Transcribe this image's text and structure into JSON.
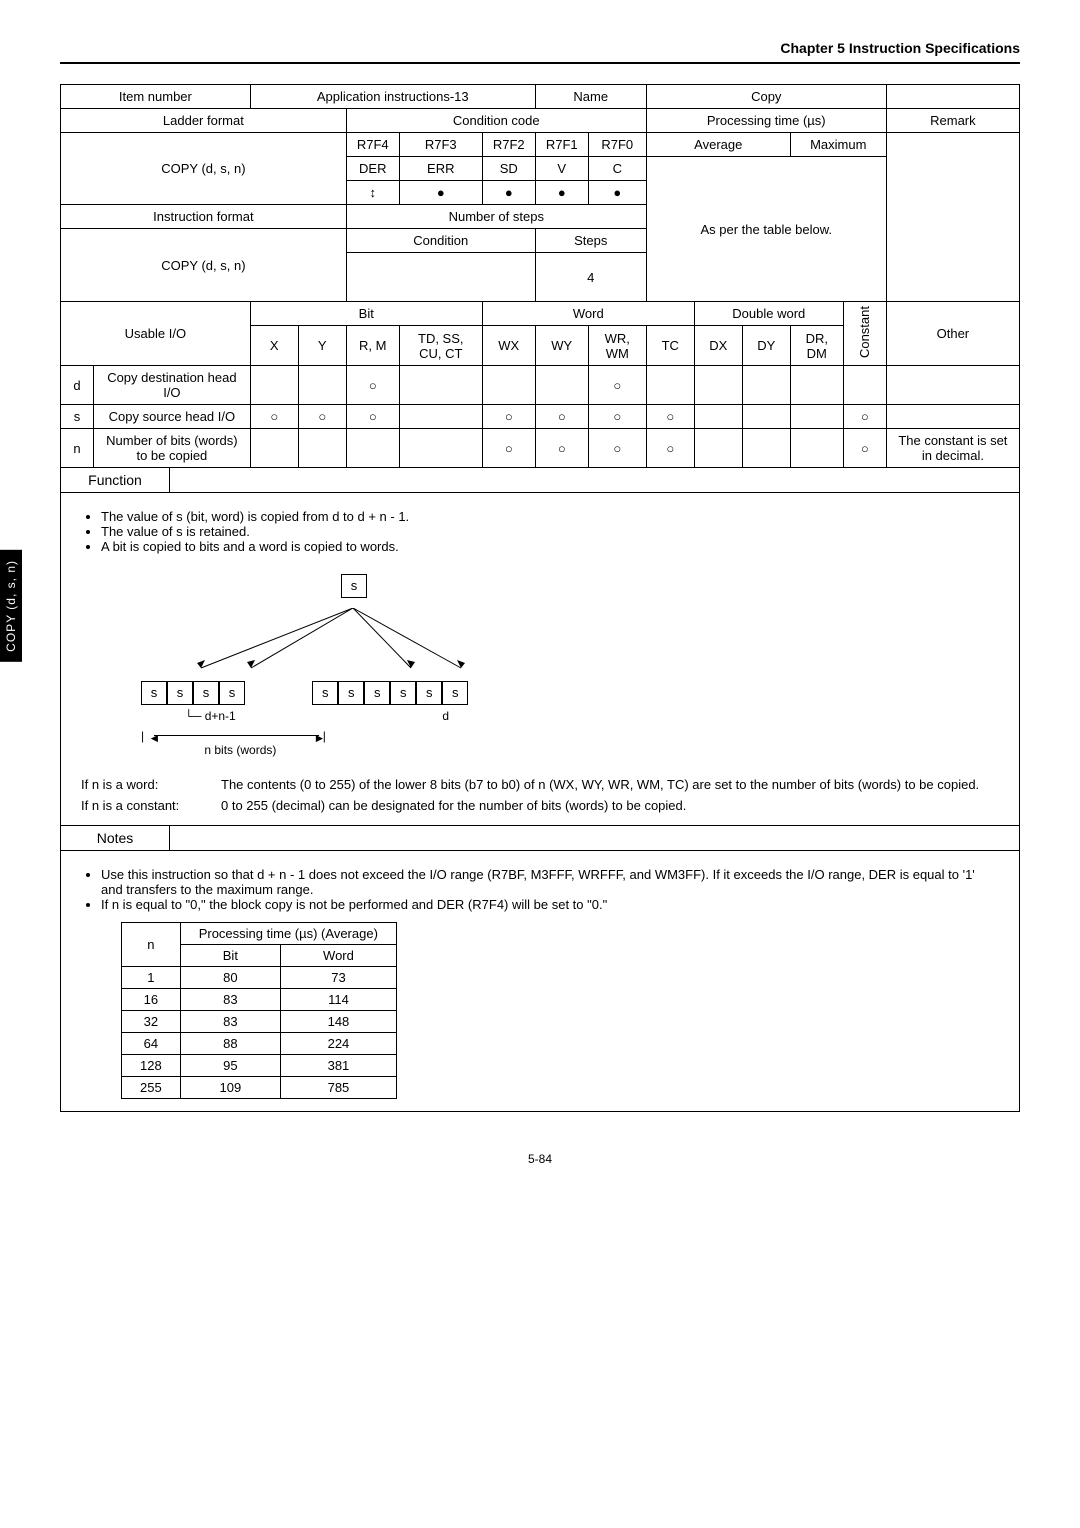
{
  "header": {
    "chapter": "Chapter 5  Instruction Specifications"
  },
  "sideTab": "COPY (d, s, n)",
  "row1": {
    "itemNumberLabel": "Item number",
    "itemNumberValue": "Application instructions-13",
    "nameLabel": "Name",
    "nameValue": "Copy"
  },
  "row2": {
    "ladderLabel": "Ladder format",
    "condLabel": "Condition code",
    "procLabel": "Processing time (µs)",
    "remarkLabel": "Remark"
  },
  "ladderValue": "COPY (d, s, n)",
  "condCols": {
    "c1": "R7F4",
    "c2": "R7F3",
    "c3": "R7F2",
    "c4": "R7F1",
    "c5": "R7F0"
  },
  "condRows": {
    "r1": {
      "c1": "DER",
      "c2": "ERR",
      "c3": "SD",
      "c4": "V",
      "c5": "C"
    }
  },
  "procCols": {
    "avg": "Average",
    "max": "Maximum"
  },
  "procNote": "As per the table below.",
  "instrFormatLabel": "Instruction format",
  "numStepsLabel": "Number of steps",
  "condLabel2": "Condition",
  "stepsLabel": "Steps",
  "instrFormatValue": "COPY (d, s, n)",
  "stepsValue": "4",
  "ioHeader": {
    "usable": "Usable I/O",
    "bit": "Bit",
    "word": "Word",
    "dword": "Double word",
    "const": "Constant",
    "other": "Other",
    "X": "X",
    "Y": "Y",
    "RM": "R, M",
    "TDSS": "TD, SS, CU, CT",
    "WX": "WX",
    "WY": "WY",
    "WRWM": "WR, WM",
    "TC": "TC",
    "DX": "DX",
    "DY": "DY",
    "DRDM": "DR, DM"
  },
  "ioRows": {
    "d": {
      "label": "d",
      "desc": "Copy destination head I/O",
      "RM": "○",
      "WRWM": "○"
    },
    "s": {
      "label": "s",
      "desc": "Copy source head I/O",
      "X": "○",
      "Y": "○",
      "RM": "○",
      "WX": "○",
      "WY": "○",
      "WRWM": "○",
      "TC": "○",
      "const": "○"
    },
    "n": {
      "label": "n",
      "desc": "Number of bits (words) to be copied",
      "WX": "○",
      "WY": "○",
      "WRWM": "○",
      "TC": "○",
      "const": "○",
      "note": "The constant is set in decimal."
    }
  },
  "functionLabel": "Function",
  "functionBullets": [
    "The value of s (bit, word) is copied from d to d + n - 1.",
    "The value of s is retained.",
    "A bit is copied to bits and a word is copied to words."
  ],
  "diagram": {
    "s": "s",
    "d": "d",
    "dn1": "d+n-1",
    "nbits": "n bits (words)"
  },
  "ifWord": {
    "label": "If n is a word:",
    "text": "The contents (0 to 255) of the lower 8 bits (b7 to b0) of n (WX, WY, WR, WM, TC) are set to the number of bits (words) to be copied."
  },
  "ifConst": {
    "label": "If n is a constant:",
    "text": "0 to 255 (decimal) can be designated for the number of bits (words) to be copied."
  },
  "notesLabel": "Notes",
  "notesBullets": [
    "Use this instruction so that d + n - 1 does not exceed the I/O range (R7BF, M3FFF, WRFFF, and WM3FF).  If it exceeds the I/O range, DER is equal to '1' and transfers to the maximum range.",
    "If n is equal to \"0,\" the block copy is not be performed and DER (R7F4) will be set to \"0.\""
  ],
  "procTable": {
    "header": {
      "n": "n",
      "title": "Processing time (µs) (Average)",
      "bit": "Bit",
      "word": "Word"
    },
    "rows": [
      {
        "n": "1",
        "bit": "80",
        "word": "73"
      },
      {
        "n": "16",
        "bit": "83",
        "word": "114"
      },
      {
        "n": "32",
        "bit": "83",
        "word": "148"
      },
      {
        "n": "64",
        "bit": "88",
        "word": "224"
      },
      {
        "n": "128",
        "bit": "95",
        "word": "381"
      },
      {
        "n": "255",
        "bit": "109",
        "word": "785"
      }
    ]
  },
  "pageNum": "5-84",
  "chart_data": {
    "type": "table",
    "title": "Processing time (µs) (Average)",
    "categories": [
      "1",
      "16",
      "32",
      "64",
      "128",
      "255"
    ],
    "series": [
      {
        "name": "Bit",
        "values": [
          80,
          83,
          83,
          88,
          95,
          109
        ]
      },
      {
        "name": "Word",
        "values": [
          73,
          114,
          148,
          224,
          381,
          785
        ]
      }
    ]
  }
}
